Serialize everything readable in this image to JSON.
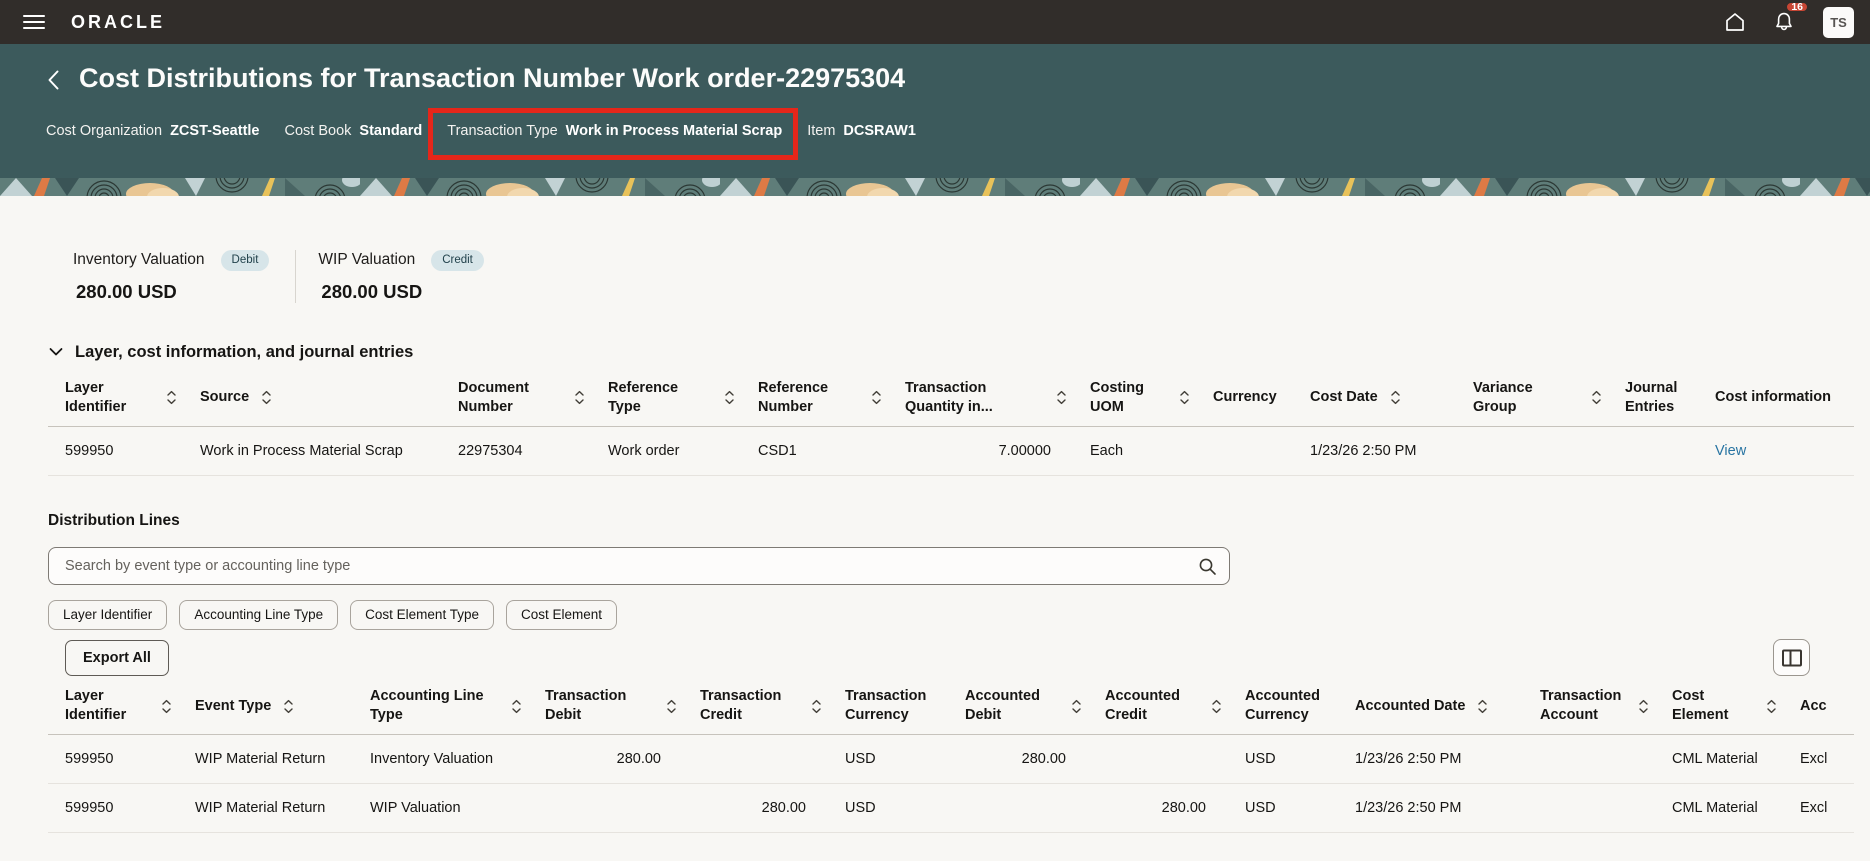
{
  "colors": {
    "topbar_bg": "#312D2A",
    "header_bg": "#3C5A5C",
    "highlight_red": "#E5261A",
    "notification_red": "#C74634",
    "badge_bg": "#D7E5E9",
    "link_blue": "#2874A2"
  },
  "topbar": {
    "brand": "ORACLE",
    "notification_count": "16",
    "avatar_initials": "TS"
  },
  "header": {
    "title": "Cost Distributions for Transaction Number Work order-22975304",
    "meta": [
      {
        "label": "Cost Organization",
        "value": "ZCST-Seattle",
        "highlighted": false
      },
      {
        "label": "Cost Book",
        "value": "Standard",
        "highlighted": false
      },
      {
        "label": "Transaction Type",
        "value": "Work in Process Material Scrap",
        "highlighted": true
      },
      {
        "label": "Item",
        "value": "DCSRAW1",
        "highlighted": false
      }
    ]
  },
  "summary": {
    "cards": [
      {
        "label": "Inventory Valuation",
        "badge": "Debit",
        "value": "280.00 USD"
      },
      {
        "label": "WIP Valuation",
        "badge": "Credit",
        "value": "280.00 USD"
      }
    ]
  },
  "layer_section": {
    "title": "Layer, cost information, and journal entries",
    "table": {
      "columns": [
        {
          "label": "Layer Identifier",
          "sortable": true
        },
        {
          "label": "Source",
          "sortable": true
        },
        {
          "label": "Document Number",
          "sortable": true
        },
        {
          "label": "Reference Type",
          "sortable": true
        },
        {
          "label": "Reference Number",
          "sortable": true
        },
        {
          "label": "Transaction Quantity in...",
          "sortable": true,
          "numeric": true
        },
        {
          "label": "Costing UOM",
          "sortable": true
        },
        {
          "label": "Currency",
          "sortable": false
        },
        {
          "label": "Cost Date",
          "sortable": true
        },
        {
          "label": "Variance Group",
          "sortable": true
        },
        {
          "label": "Journal Entries",
          "sortable": false
        },
        {
          "label": "Cost information",
          "sortable": false,
          "link": true
        }
      ],
      "rows": [
        [
          "599950",
          "Work in Process Material Scrap",
          "22975304",
          "Work order",
          "CSD1",
          "7.00000",
          "Each",
          "",
          "1/23/26 2:50 PM",
          "",
          "",
          "View"
        ]
      ]
    }
  },
  "distribution_section": {
    "title": "Distribution Lines",
    "search_placeholder": "Search by event type or accounting line type",
    "filters": [
      "Layer Identifier",
      "Accounting Line Type",
      "Cost Element Type",
      "Cost Element"
    ],
    "export_label": "Export All",
    "table": {
      "columns": [
        {
          "label": "Layer Identifier",
          "sortable": true
        },
        {
          "label": "Event Type",
          "sortable": true
        },
        {
          "label": "Accounting Line Type",
          "sortable": true
        },
        {
          "label": "Transaction Debit",
          "sortable": true,
          "numeric": true
        },
        {
          "label": "Transaction Credit",
          "sortable": true,
          "numeric": true
        },
        {
          "label": "Transaction Currency",
          "sortable": false
        },
        {
          "label": "Accounted Debit",
          "sortable": true,
          "numeric": true
        },
        {
          "label": "Accounted Credit",
          "sortable": true,
          "numeric": true
        },
        {
          "label": "Accounted Currency",
          "sortable": false
        },
        {
          "label": "Accounted Date",
          "sortable": true
        },
        {
          "label": "Transaction Account",
          "sortable": true
        },
        {
          "label": "Cost Element",
          "sortable": true
        },
        {
          "label": "Acc",
          "sortable": false
        }
      ],
      "rows": [
        [
          "599950",
          "WIP Material Return",
          "Inventory Valuation",
          "280.00",
          "",
          "USD",
          "280.00",
          "",
          "USD",
          "1/23/26 2:50 PM",
          "",
          "CML Material",
          "Excl"
        ],
        [
          "599950",
          "WIP Material Return",
          "WIP Valuation",
          "",
          "280.00",
          "USD",
          "",
          "280.00",
          "USD",
          "1/23/26 2:50 PM",
          "",
          "CML Material",
          "Excl"
        ]
      ]
    }
  }
}
